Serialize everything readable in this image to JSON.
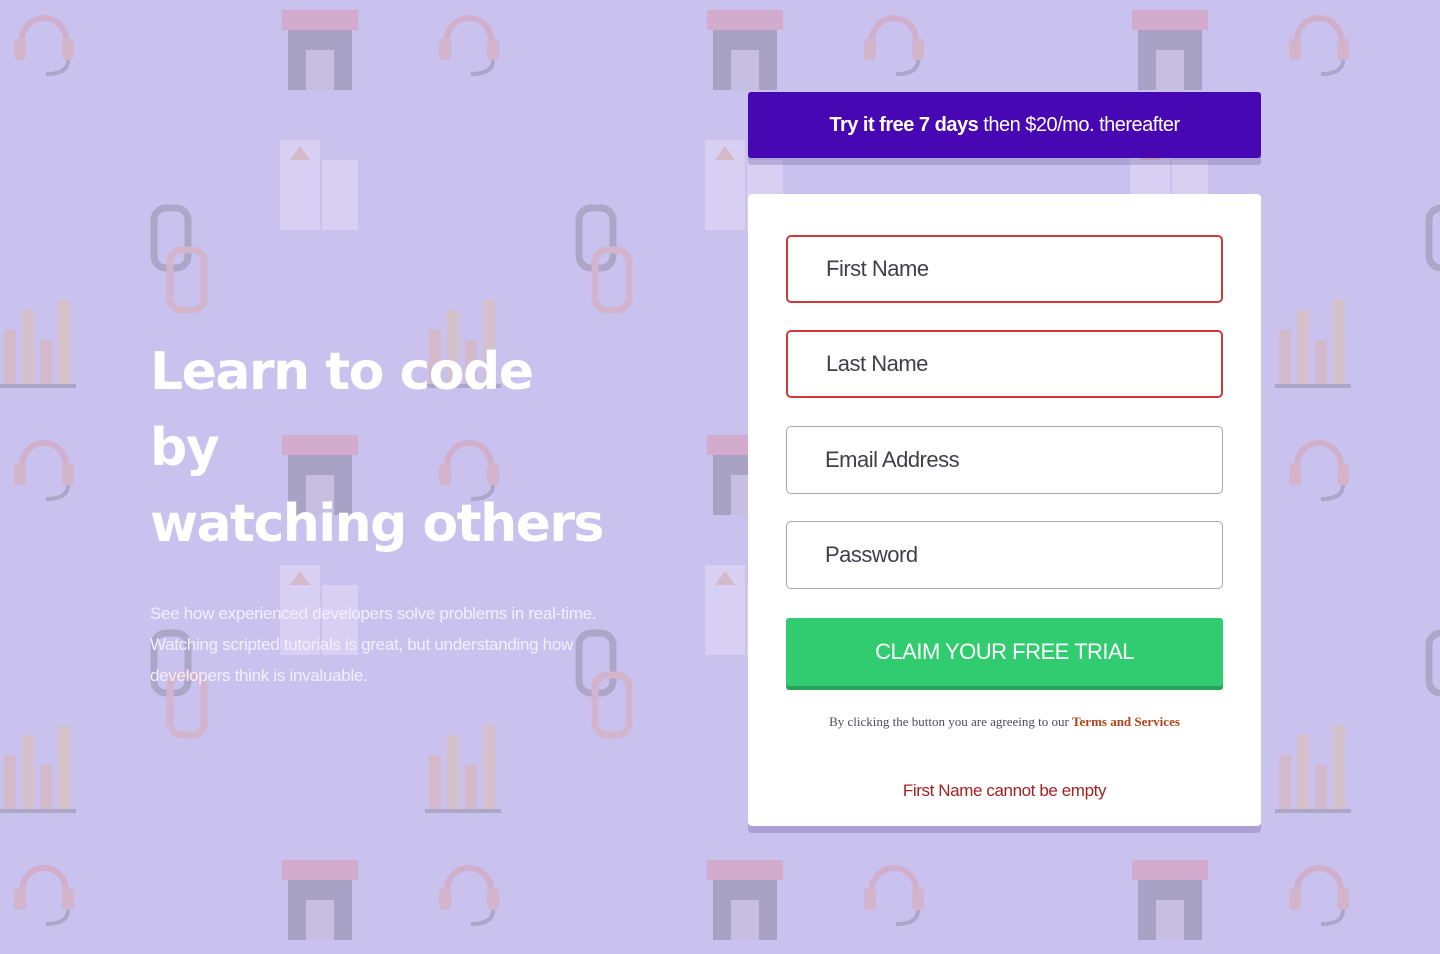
{
  "hero": {
    "title_line1": "Learn to code by",
    "title_line2": "watching others",
    "description": "See how experienced developers solve problems in real-time. Watching scripted tutorials is great, but understanding how developers think is invaluable."
  },
  "promo": {
    "bold": "Try it free 7 days",
    "rest": " then $20/mo. thereafter"
  },
  "form": {
    "first_name_placeholder": "First Name",
    "last_name_placeholder": "Last Name",
    "email_placeholder": "Email Address",
    "password_placeholder": "Password",
    "submit_label": "CLAIM YOUR FREE TRIAL",
    "terms_text": "By clicking the button you are agreeing to our ",
    "terms_link": "Terms and Services",
    "error_message": "First Name cannot be empty"
  },
  "colors": {
    "background": "#cdc6ee",
    "promo_bg": "#4708b3",
    "button_bg": "#31cc6f",
    "error": "#cc3a3a",
    "link": "#b14218"
  },
  "icons": [
    "headset-icon",
    "shop-icon",
    "chain-link-icon",
    "bar-chart-icon",
    "rocket-icon",
    "gear-icon",
    "globe-icon",
    "lifebuoy-icon",
    "calendar-icon",
    "lightbulb-icon",
    "browser-window-icon",
    "document-icon"
  ]
}
